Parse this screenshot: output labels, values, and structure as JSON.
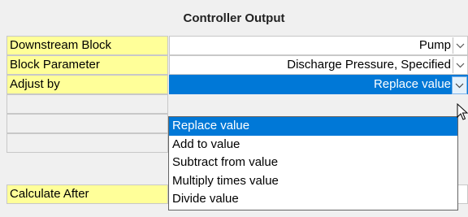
{
  "header": {
    "title": "Controller Output"
  },
  "rows": [
    {
      "label": "Downstream Block",
      "value": "Pump"
    },
    {
      "label": "Block Parameter",
      "value": "Discharge Pressure, Specified"
    },
    {
      "label": "Adjust by",
      "value": "Replace value"
    },
    {
      "label": "Calculate After",
      "value": ""
    }
  ],
  "dropdown": {
    "options": [
      "Replace value",
      "Add to value",
      "Subtract from value",
      "Multiply times value",
      "Divide value"
    ],
    "selected": "Replace value"
  },
  "colors": {
    "label_bg": "#ffff99",
    "selection": "#0078d7"
  },
  "icons": {
    "dropdown": "chevron-down-icon",
    "cursor": "mouse-pointer-icon"
  }
}
